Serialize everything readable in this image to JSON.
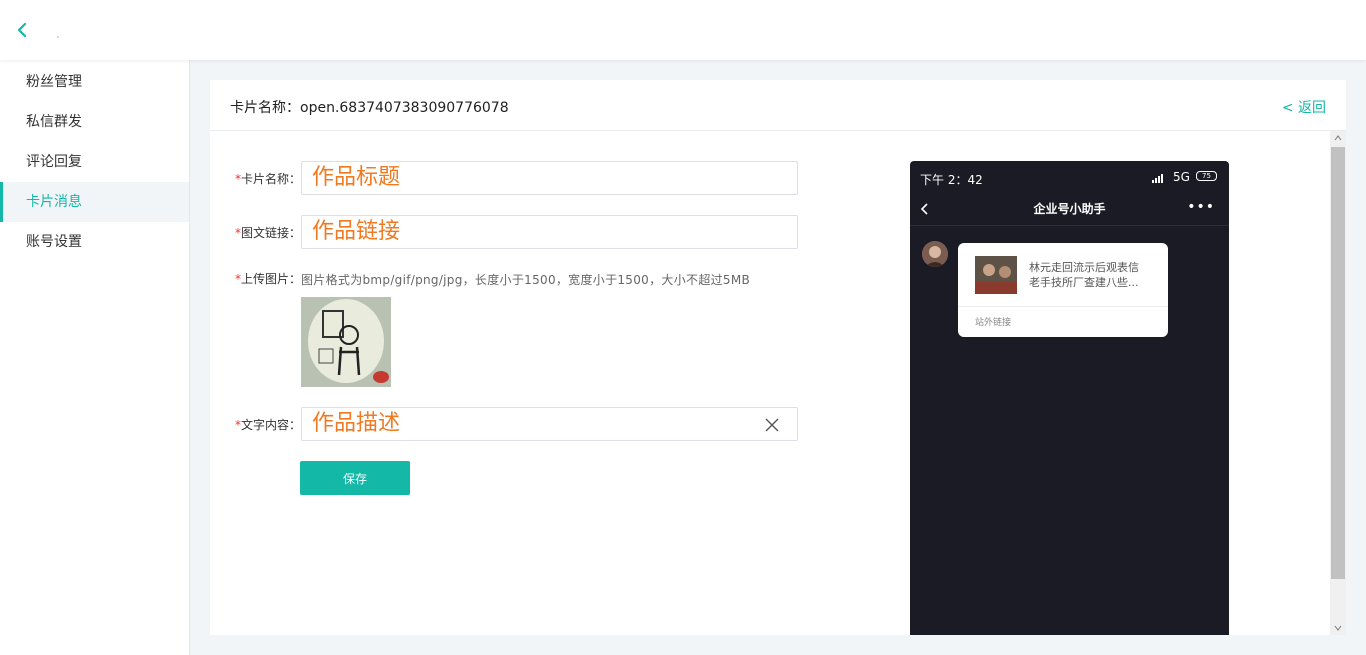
{
  "sidebar": {
    "items": [
      {
        "label": "粉丝管理"
      },
      {
        "label": "私信群发"
      },
      {
        "label": "评论回复"
      },
      {
        "label": "卡片消息",
        "active": true
      },
      {
        "label": "账号设置"
      }
    ]
  },
  "header": {
    "title_prefix": "卡片名称：",
    "title_value": "open.6837407383090776078",
    "return_label": "< 返回"
  },
  "form": {
    "required_mark": "*",
    "card_name": {
      "label": "卡片名称：",
      "value": "作品标题"
    },
    "link": {
      "label": "图文链接：",
      "value": "作品链接"
    },
    "upload": {
      "label": "上传图片：",
      "hint": "图片格式为bmp/gif/png/jpg，长度小于1500，宽度小于1500，大小不超过5MB"
    },
    "text": {
      "label": "文字内容：",
      "value": "作品描述"
    },
    "save_label": "保存"
  },
  "phone": {
    "time": "下午 2：42",
    "network": "5G",
    "battery": "75",
    "nav_title": "企业号小助手",
    "nav_more": "•••",
    "message": {
      "line1": "林元走回流示后观表信",
      "line2": "老手技所厂查建八些...",
      "footer": "站外链接"
    }
  },
  "colors": {
    "accent": "#14b8a6",
    "value_text": "#f07a22",
    "required": "#e53935",
    "phone_bg": "#1a1b24"
  }
}
